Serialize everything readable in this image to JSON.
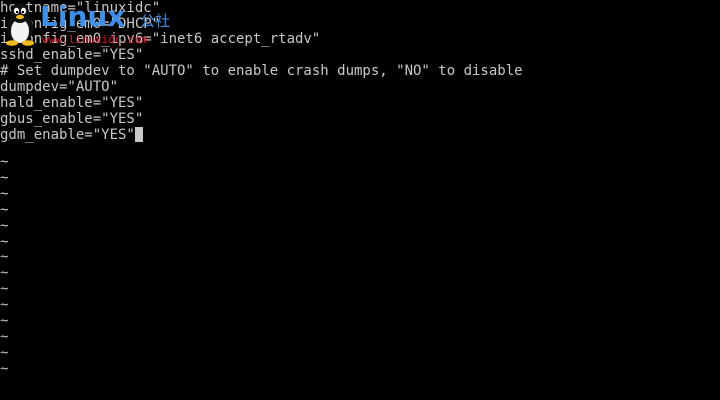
{
  "editor": {
    "lines": [
      "hostname=\"linuxidc\"",
      "ifconfig_em0=\"DHCP\"",
      "ifconfig_em0_ipv6=\"inet6 accept_rtadv\"",
      "sshd_enable=\"YES\"",
      "# Set dumpdev to \"AUTO\" to enable crash dumps, \"NO\" to disable",
      "dumpdev=\"AUTO\"",
      "hald_enable=\"YES\"",
      "gbus_enable=\"YES\"",
      "gdm_enable=\"YES\""
    ],
    "empty_line_marker": "~",
    "empty_line_count": 14
  },
  "watermark": {
    "brand": "Linux",
    "brand_cn": "公社",
    "url": "www.linuxidc.com"
  },
  "colors": {
    "background": "#000000",
    "text": "#c8c8c8",
    "watermark_blue": "#3f8fe8",
    "watermark_red": "#d8192a"
  }
}
